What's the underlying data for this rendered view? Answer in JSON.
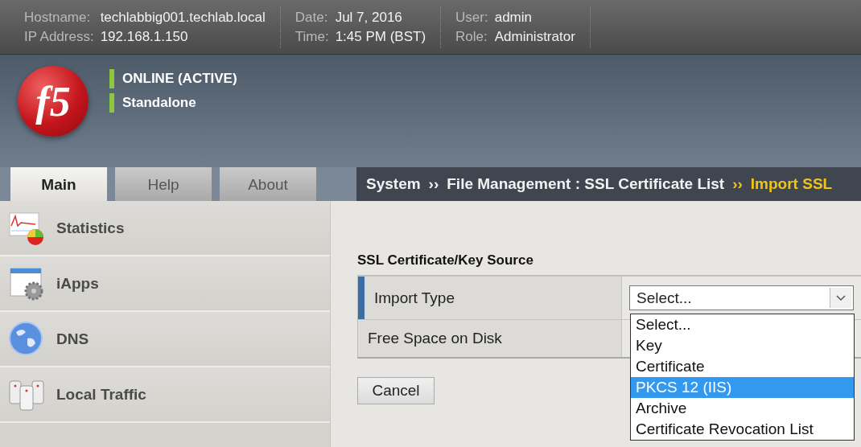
{
  "top_bar": {
    "groups": [
      {
        "fields": [
          {
            "label": "Hostname:",
            "value": "techlabbig001.techlab.local"
          },
          {
            "label": "IP Address:",
            "value": "192.168.1.150"
          }
        ]
      },
      {
        "fields": [
          {
            "label": "Date:",
            "value": "Jul 7, 2016"
          },
          {
            "label": "Time:",
            "value": "1:45 PM (BST)"
          }
        ]
      },
      {
        "fields": [
          {
            "label": "User:",
            "value": "admin"
          },
          {
            "label": "Role:",
            "value": "Administrator"
          }
        ]
      }
    ]
  },
  "header": {
    "logo": "f5",
    "status": [
      "ONLINE (ACTIVE)",
      "Standalone"
    ]
  },
  "tabs": [
    {
      "label": "Main",
      "selected": true
    },
    {
      "label": "Help",
      "selected": false
    },
    {
      "label": "About",
      "selected": false
    }
  ],
  "sidebar": {
    "items": [
      {
        "label": "Statistics"
      },
      {
        "label": "iApps"
      },
      {
        "label": "DNS"
      },
      {
        "label": "Local Traffic"
      }
    ]
  },
  "breadcrumb": {
    "separator": "››",
    "items": [
      {
        "text": "System",
        "current": false
      },
      {
        "text": "File Management : SSL Certificate List",
        "current": false
      },
      {
        "text": "Import SSL",
        "current": true
      }
    ]
  },
  "form": {
    "section_title": "SSL Certificate/Key Source",
    "rows": [
      {
        "label": "Import Type",
        "selected": true,
        "kind": "select",
        "value": "Select..."
      },
      {
        "label": "Free Space on Disk",
        "selected": false,
        "kind": "text"
      }
    ]
  },
  "dropdown": {
    "open": true,
    "options": [
      {
        "label": "Select...",
        "selected": false
      },
      {
        "label": "Key",
        "selected": false
      },
      {
        "label": "Certificate",
        "selected": false
      },
      {
        "label": "PKCS 12 (IIS)",
        "selected": true
      },
      {
        "label": "Archive",
        "selected": false
      },
      {
        "label": "Certificate Revocation List",
        "selected": false
      }
    ]
  },
  "buttons": [
    "Cancel"
  ]
}
